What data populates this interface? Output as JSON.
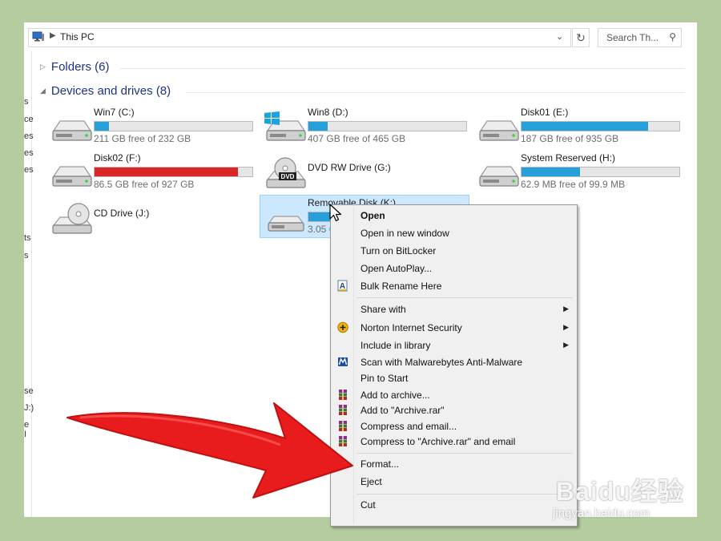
{
  "address_bar": {
    "location": "This PC",
    "search_placeholder": "Search Th..."
  },
  "groups": {
    "folders": {
      "label": "Folders (6)"
    },
    "devices": {
      "label": "Devices and drives (8)"
    }
  },
  "drives": [
    {
      "name": "Win7 (C:)",
      "free": "211 GB free of 232 GB",
      "used_fraction": 0.09,
      "bar_color": "#26a0da",
      "icon": "hard-drive-icon"
    },
    {
      "name": "Win8 (D:)",
      "free": "407 GB free of 465 GB",
      "used_fraction": 0.12,
      "bar_color": "#26a0da",
      "icon": "windows-drive-icon"
    },
    {
      "name": "Disk01 (E:)",
      "free": "187 GB free of 935 GB",
      "used_fraction": 0.8,
      "bar_color": "#26a0da",
      "icon": "hard-drive-icon"
    },
    {
      "name": "Disk02 (F:)",
      "free": "86.5 GB free of 927 GB",
      "used_fraction": 0.91,
      "bar_color": "#da2626",
      "icon": "hard-drive-icon"
    },
    {
      "name": "DVD RW Drive (G:)",
      "icon": "dvd-drive-icon"
    },
    {
      "name": "System Reserved (H:)",
      "free": "62.9 MB free of 99.9 MB",
      "used_fraction": 0.37,
      "bar_color": "#26a0da",
      "icon": "hard-drive-icon"
    },
    {
      "name": "CD Drive (J:)",
      "icon": "cd-drive-icon"
    },
    {
      "name": "Removable Disk (K:)",
      "free": "3.05 G",
      "used_fraction": 0.15,
      "bar_color": "#26a0da",
      "icon": "removable-disk-icon",
      "selected": true
    }
  ],
  "left_pane_fragments": [
    "s",
    "ce",
    "es",
    "es",
    "es",
    "ts",
    "s",
    "se",
    "J:)",
    "e I"
  ],
  "context_menu": {
    "items": [
      {
        "label": "Open"
      },
      {
        "label": "Open in new window"
      },
      {
        "label": "Turn on BitLocker"
      },
      {
        "label": "Open AutoPlay..."
      },
      {
        "label": "Bulk Rename Here",
        "icon": "bulk-rename-icon"
      },
      {
        "label": "Share with"
      },
      {
        "label": "Norton Internet Security",
        "icon": "norton-icon"
      },
      {
        "label": "Include in library"
      },
      {
        "label": "Scan with Malwarebytes Anti-Malware",
        "icon": "malwarebytes-icon"
      },
      {
        "label": "Pin to Start"
      },
      {
        "label": "Add to archive...",
        "icon": "winrar-icon"
      },
      {
        "label": "Add to \"Archive.rar\"",
        "icon": "winrar-icon"
      },
      {
        "label": "Compress and email...",
        "icon": "winrar-icon"
      },
      {
        "label": "Compress to \"Archive.rar\" and email",
        "icon": "winrar-icon"
      },
      {
        "label": "Format..."
      },
      {
        "label": "Eject"
      },
      {
        "label": "Cut"
      }
    ]
  },
  "watermark": {
    "logo": "Baidu经验",
    "url": "jingyan.baidu.com"
  },
  "colors": {
    "frame": "#b5cca0",
    "selection": "#cce8ff",
    "bar_blue": "#26a0da",
    "bar_red": "#da2626",
    "arrow_red": "#e81c1c"
  }
}
